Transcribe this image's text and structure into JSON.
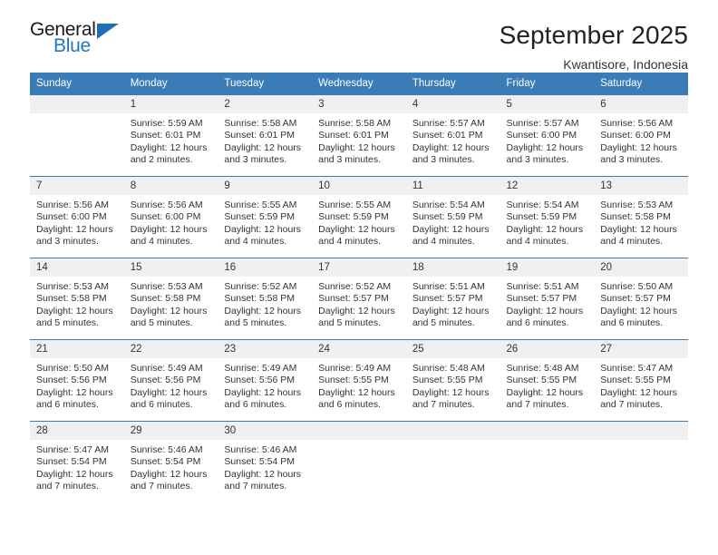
{
  "brand": {
    "name_top": "General",
    "name_bottom": "Blue",
    "accent_color": "#1f77c4",
    "header_color": "#3a7cb8"
  },
  "header": {
    "title": "September 2025",
    "subtitle": "Kwantisore, Indonesia"
  },
  "calendar": {
    "weekday_headers": [
      "Sunday",
      "Monday",
      "Tuesday",
      "Wednesday",
      "Thursday",
      "Friday",
      "Saturday"
    ],
    "weeks": [
      [
        {
          "day": "",
          "lines": []
        },
        {
          "day": "1",
          "lines": [
            "Sunrise: 5:59 AM",
            "Sunset: 6:01 PM",
            "Daylight: 12 hours",
            "and 2 minutes."
          ]
        },
        {
          "day": "2",
          "lines": [
            "Sunrise: 5:58 AM",
            "Sunset: 6:01 PM",
            "Daylight: 12 hours",
            "and 3 minutes."
          ]
        },
        {
          "day": "3",
          "lines": [
            "Sunrise: 5:58 AM",
            "Sunset: 6:01 PM",
            "Daylight: 12 hours",
            "and 3 minutes."
          ]
        },
        {
          "day": "4",
          "lines": [
            "Sunrise: 5:57 AM",
            "Sunset: 6:01 PM",
            "Daylight: 12 hours",
            "and 3 minutes."
          ]
        },
        {
          "day": "5",
          "lines": [
            "Sunrise: 5:57 AM",
            "Sunset: 6:00 PM",
            "Daylight: 12 hours",
            "and 3 minutes."
          ]
        },
        {
          "day": "6",
          "lines": [
            "Sunrise: 5:56 AM",
            "Sunset: 6:00 PM",
            "Daylight: 12 hours",
            "and 3 minutes."
          ]
        }
      ],
      [
        {
          "day": "7",
          "lines": [
            "Sunrise: 5:56 AM",
            "Sunset: 6:00 PM",
            "Daylight: 12 hours",
            "and 3 minutes."
          ]
        },
        {
          "day": "8",
          "lines": [
            "Sunrise: 5:56 AM",
            "Sunset: 6:00 PM",
            "Daylight: 12 hours",
            "and 4 minutes."
          ]
        },
        {
          "day": "9",
          "lines": [
            "Sunrise: 5:55 AM",
            "Sunset: 5:59 PM",
            "Daylight: 12 hours",
            "and 4 minutes."
          ]
        },
        {
          "day": "10",
          "lines": [
            "Sunrise: 5:55 AM",
            "Sunset: 5:59 PM",
            "Daylight: 12 hours",
            "and 4 minutes."
          ]
        },
        {
          "day": "11",
          "lines": [
            "Sunrise: 5:54 AM",
            "Sunset: 5:59 PM",
            "Daylight: 12 hours",
            "and 4 minutes."
          ]
        },
        {
          "day": "12",
          "lines": [
            "Sunrise: 5:54 AM",
            "Sunset: 5:59 PM",
            "Daylight: 12 hours",
            "and 4 minutes."
          ]
        },
        {
          "day": "13",
          "lines": [
            "Sunrise: 5:53 AM",
            "Sunset: 5:58 PM",
            "Daylight: 12 hours",
            "and 4 minutes."
          ]
        }
      ],
      [
        {
          "day": "14",
          "lines": [
            "Sunrise: 5:53 AM",
            "Sunset: 5:58 PM",
            "Daylight: 12 hours",
            "and 5 minutes."
          ]
        },
        {
          "day": "15",
          "lines": [
            "Sunrise: 5:53 AM",
            "Sunset: 5:58 PM",
            "Daylight: 12 hours",
            "and 5 minutes."
          ]
        },
        {
          "day": "16",
          "lines": [
            "Sunrise: 5:52 AM",
            "Sunset: 5:58 PM",
            "Daylight: 12 hours",
            "and 5 minutes."
          ]
        },
        {
          "day": "17",
          "lines": [
            "Sunrise: 5:52 AM",
            "Sunset: 5:57 PM",
            "Daylight: 12 hours",
            "and 5 minutes."
          ]
        },
        {
          "day": "18",
          "lines": [
            "Sunrise: 5:51 AM",
            "Sunset: 5:57 PM",
            "Daylight: 12 hours",
            "and 5 minutes."
          ]
        },
        {
          "day": "19",
          "lines": [
            "Sunrise: 5:51 AM",
            "Sunset: 5:57 PM",
            "Daylight: 12 hours",
            "and 6 minutes."
          ]
        },
        {
          "day": "20",
          "lines": [
            "Sunrise: 5:50 AM",
            "Sunset: 5:57 PM",
            "Daylight: 12 hours",
            "and 6 minutes."
          ]
        }
      ],
      [
        {
          "day": "21",
          "lines": [
            "Sunrise: 5:50 AM",
            "Sunset: 5:56 PM",
            "Daylight: 12 hours",
            "and 6 minutes."
          ]
        },
        {
          "day": "22",
          "lines": [
            "Sunrise: 5:49 AM",
            "Sunset: 5:56 PM",
            "Daylight: 12 hours",
            "and 6 minutes."
          ]
        },
        {
          "day": "23",
          "lines": [
            "Sunrise: 5:49 AM",
            "Sunset: 5:56 PM",
            "Daylight: 12 hours",
            "and 6 minutes."
          ]
        },
        {
          "day": "24",
          "lines": [
            "Sunrise: 5:49 AM",
            "Sunset: 5:55 PM",
            "Daylight: 12 hours",
            "and 6 minutes."
          ]
        },
        {
          "day": "25",
          "lines": [
            "Sunrise: 5:48 AM",
            "Sunset: 5:55 PM",
            "Daylight: 12 hours",
            "and 7 minutes."
          ]
        },
        {
          "day": "26",
          "lines": [
            "Sunrise: 5:48 AM",
            "Sunset: 5:55 PM",
            "Daylight: 12 hours",
            "and 7 minutes."
          ]
        },
        {
          "day": "27",
          "lines": [
            "Sunrise: 5:47 AM",
            "Sunset: 5:55 PM",
            "Daylight: 12 hours",
            "and 7 minutes."
          ]
        }
      ],
      [
        {
          "day": "28",
          "lines": [
            "Sunrise: 5:47 AM",
            "Sunset: 5:54 PM",
            "Daylight: 12 hours",
            "and 7 minutes."
          ]
        },
        {
          "day": "29",
          "lines": [
            "Sunrise: 5:46 AM",
            "Sunset: 5:54 PM",
            "Daylight: 12 hours",
            "and 7 minutes."
          ]
        },
        {
          "day": "30",
          "lines": [
            "Sunrise: 5:46 AM",
            "Sunset: 5:54 PM",
            "Daylight: 12 hours",
            "and 7 minutes."
          ]
        },
        {
          "day": "",
          "lines": []
        },
        {
          "day": "",
          "lines": []
        },
        {
          "day": "",
          "lines": []
        },
        {
          "day": "",
          "lines": []
        }
      ]
    ]
  }
}
